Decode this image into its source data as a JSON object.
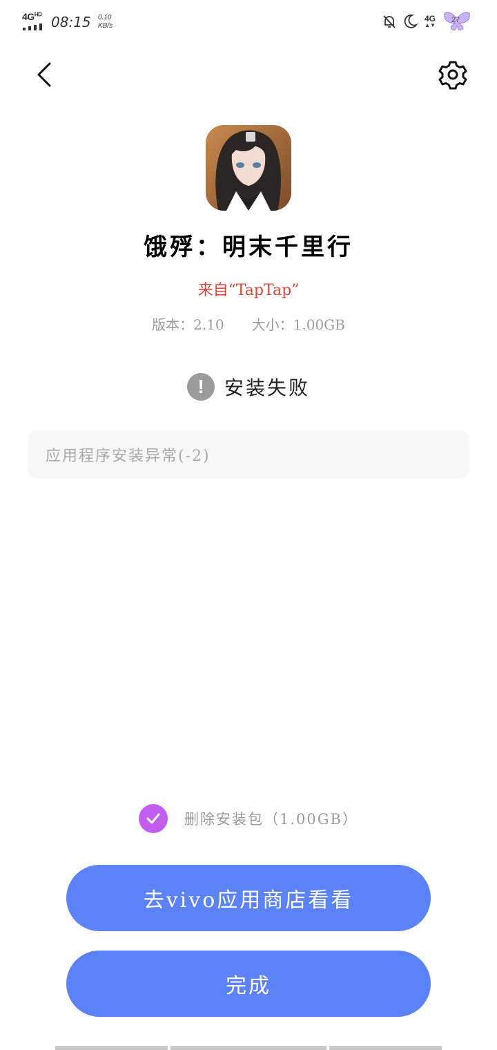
{
  "status_bar": {
    "network": "4G",
    "network_sup": "HD",
    "time": "08:15",
    "speed_value": "0.10",
    "speed_unit": "KB/s",
    "network_right": "4G",
    "battery_level": "27",
    "icons": [
      "bell-off-icon",
      "moon-icon",
      "signal-4g-icon",
      "battery-icon"
    ]
  },
  "header": {
    "back_icon": "chevron-left-icon",
    "settings_icon": "gear-icon"
  },
  "app": {
    "name": "饿殍：明末千里行",
    "source": "来自“TapTap”",
    "version_label": "版本：2.10",
    "size_label": "大小：1.00GB"
  },
  "install": {
    "status_icon": "!",
    "status_text": "安装失败",
    "error_text": "应用程序安装异常(-2)"
  },
  "delete_package": {
    "checked": true,
    "label": "删除安装包（1.00GB）"
  },
  "buttons": {
    "store_label": "去vivo应用商店看看",
    "done_label": "完成"
  },
  "colors": {
    "primary_button": "#5b82f7",
    "checkbox": "#c15ef0",
    "source_text": "#d9483b",
    "error_bg": "#f7f7f7"
  }
}
